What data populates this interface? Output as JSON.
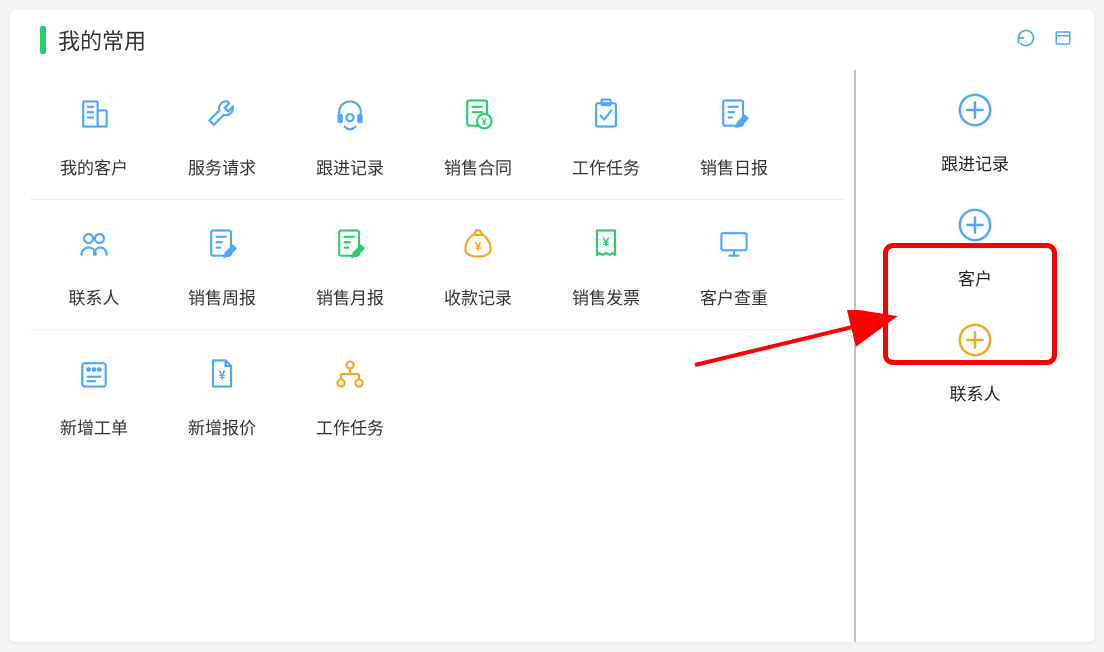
{
  "header": {
    "title": "我的常用"
  },
  "grid": {
    "rows": [
      [
        {
          "label": "我的客户",
          "icon": "building",
          "color": "#4da6ff"
        },
        {
          "label": "服务请求",
          "icon": "wrench",
          "color": "#4da6ff"
        },
        {
          "label": "跟进记录",
          "icon": "headset",
          "color": "#4da6ff"
        },
        {
          "label": "销售合同",
          "icon": "doc-yen",
          "color": "#2ecc71"
        },
        {
          "label": "工作任务",
          "icon": "clipboard-check",
          "color": "#4da6ff"
        },
        {
          "label": "销售日报",
          "icon": "doc-edit",
          "color": "#4da6ff"
        }
      ],
      [
        {
          "label": "联系人",
          "icon": "people",
          "color": "#4da6ff"
        },
        {
          "label": "销售周报",
          "icon": "doc-edit",
          "color": "#4da6ff"
        },
        {
          "label": "销售月报",
          "icon": "doc-edit",
          "color": "#2ecc71"
        },
        {
          "label": "收款记录",
          "icon": "moneybag",
          "color": "#f5a623"
        },
        {
          "label": "销售发票",
          "icon": "receipt-yen",
          "color": "#2ecc71"
        },
        {
          "label": "客户查重",
          "icon": "monitor",
          "color": "#4da6ff"
        }
      ],
      [
        {
          "label": "新增工单",
          "icon": "ticket",
          "color": "#4da6ff"
        },
        {
          "label": "新增报价",
          "icon": "doc-yen-plain",
          "color": "#4da6ff"
        },
        {
          "label": "工作任务",
          "icon": "org-chart",
          "color": "#f5a623"
        }
      ]
    ]
  },
  "side": {
    "items": [
      {
        "label": "跟进记录",
        "color": "#4da6ff"
      },
      {
        "label": "客户",
        "color": "#4da6ff"
      },
      {
        "label": "联系人",
        "color": "#f5a623"
      }
    ]
  }
}
